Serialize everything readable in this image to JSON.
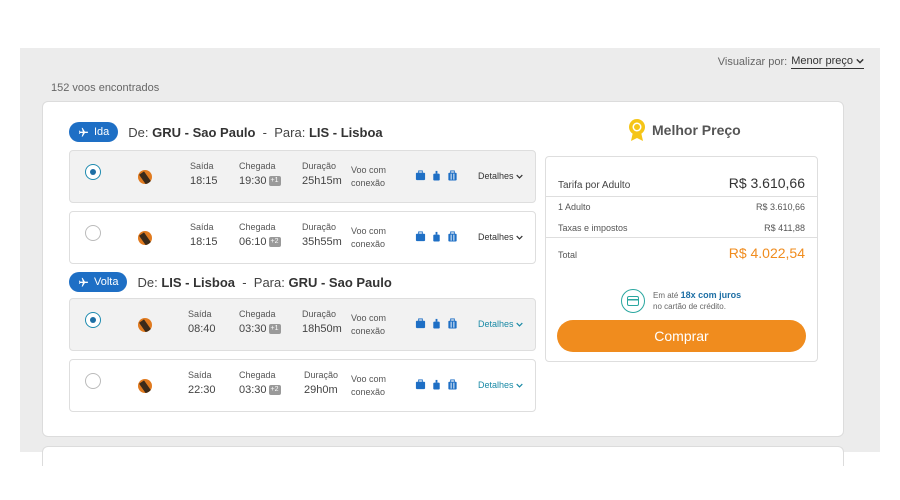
{
  "sort": {
    "label": "Visualizar por:",
    "selected": "Menor preço"
  },
  "results_count": "152 voos encontrados",
  "legs": [
    {
      "badge": "Ida",
      "from_prefix": "De:",
      "from": "GRU - Sao Paulo",
      "to_prefix": "Para:",
      "to": "LIS - Lisboa",
      "flights": [
        {
          "selected": true,
          "saida_label": "Saída",
          "saida": "18:15",
          "chegada_label": "Chegada",
          "chegada": "19:30",
          "plus_days": "+1",
          "duracao_label": "Duração",
          "duracao": "25h15m",
          "conn_line1": "Voo com",
          "conn_line2": "conexão",
          "details": "Detalhes"
        },
        {
          "selected": false,
          "saida_label": "Saída",
          "saida": "18:15",
          "chegada_label": "Chegada",
          "chegada": "06:10",
          "plus_days": "+2",
          "duracao_label": "Duração",
          "duracao": "35h55m",
          "conn_line1": "Voo com",
          "conn_line2": "conexão",
          "details": "Detalhes"
        }
      ]
    },
    {
      "badge": "Volta",
      "from_prefix": "De:",
      "from": "LIS - Lisboa",
      "to_prefix": "Para:",
      "to": "GRU - Sao Paulo",
      "flights": [
        {
          "selected": true,
          "saida_label": "Saída",
          "saida": "08:40",
          "chegada_label": "Chegada",
          "chegada": "03:30",
          "plus_days": "+1",
          "duracao_label": "Duração",
          "duracao": "18h50m",
          "conn_line1": "Voo com",
          "conn_line2": "conexão",
          "details": "Detalhes"
        },
        {
          "selected": false,
          "saida_label": "Saída",
          "saida": "22:30",
          "chegada_label": "Chegada",
          "chegada": "03:30",
          "plus_days": "+2",
          "duracao_label": "Duração",
          "duracao": "29h0m",
          "conn_line1": "Voo com",
          "conn_line2": "conexão",
          "details": "Detalhes"
        }
      ]
    }
  ],
  "best_price": {
    "title": "Melhor Preço",
    "fare_label": "Tarifa por Adulto",
    "fare_value": "R$ 3.610,66",
    "adults_label": "1 Adulto",
    "adults_value": "R$ 3.610,66",
    "taxes_label": "Taxas e impostos",
    "taxes_value": "R$ 411,88",
    "total_label": "Total",
    "total_value": "R$ 4.022,54",
    "installments_prefix": "Em até",
    "installments_highlight": "18x com juros",
    "installments_suffix": "no cartão de crédito.",
    "buy_label": "Comprar"
  },
  "icons": [
    "chevron-down-icon",
    "airplane-icon",
    "airline-logo",
    "luggage-icon",
    "medal-icon",
    "credit-card-icon"
  ],
  "colors": {
    "primary_blue": "#1e6fc5",
    "orange": "#f08c1e",
    "teal": "#2aa7a0",
    "background": "#ececec"
  }
}
